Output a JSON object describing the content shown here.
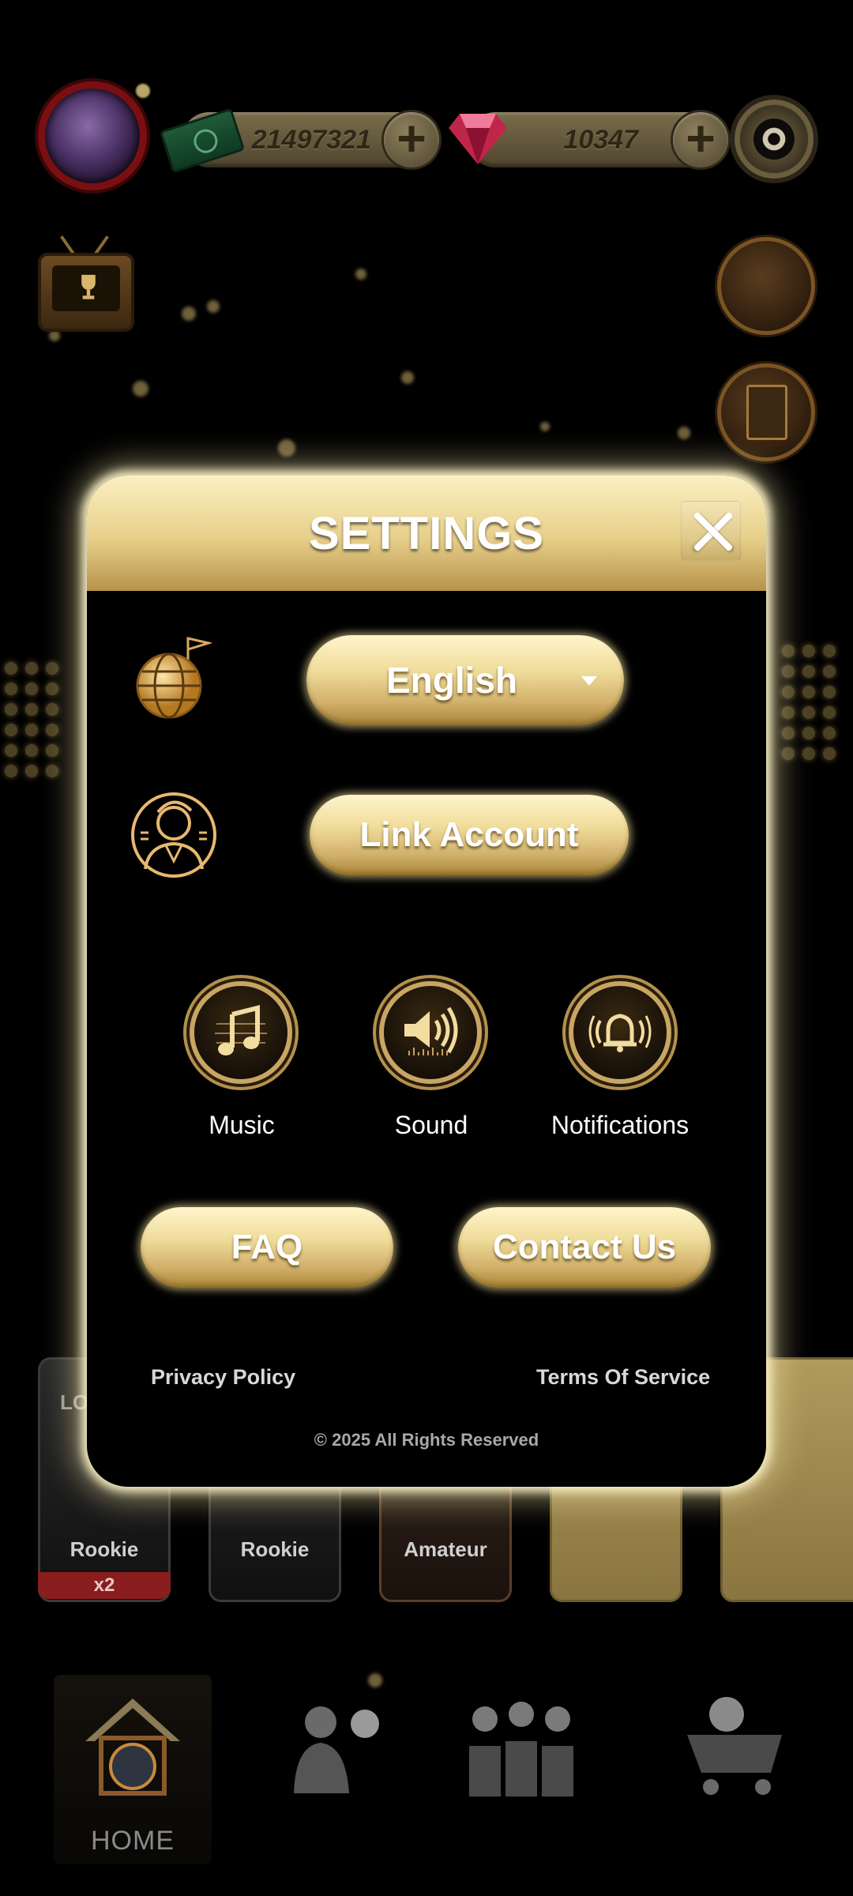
{
  "hud": {
    "cash_amount": "21497321",
    "gems_amount": "10347",
    "plus_symbol": "+"
  },
  "icons": {
    "avatar": "player-avatar",
    "cash": "cash-stack-icon",
    "gems": "ruby-gem-icon",
    "settings": "soccer-gear-icon",
    "tv": "trophy-tv-icon",
    "tactics": "whistle-clipboard-icon",
    "locker": "locker-icon",
    "language": "globe-flag-icon",
    "account": "user-profile-icon",
    "music": "music-note-icon",
    "sound": "speaker-icon",
    "notifications": "bell-icon"
  },
  "cards": [
    {
      "label": "Rookie",
      "ribbon": "x2",
      "tag": "LO"
    },
    {
      "label": "Rookie"
    },
    {
      "label": "Amateur"
    }
  ],
  "nav": {
    "home_label": "HOME"
  },
  "settings": {
    "title": "SETTINGS",
    "language_value": "English",
    "link_account_label": "Link Account",
    "toggles": {
      "music": "Music",
      "sound": "Sound",
      "notifications": "Notifications"
    },
    "faq_label": "FAQ",
    "contact_label": "Contact Us",
    "privacy_label": "Privacy Policy",
    "terms_label": "Terms Of Service",
    "copyright": "© 2025 All Rights Reserved"
  },
  "colors": {
    "gold_light": "#fbf0c2",
    "gold_mid": "#e7cf8a",
    "gold_dark": "#b7924a",
    "modal_bg": "#000000",
    "ribbon_red": "#8a1d1d"
  }
}
